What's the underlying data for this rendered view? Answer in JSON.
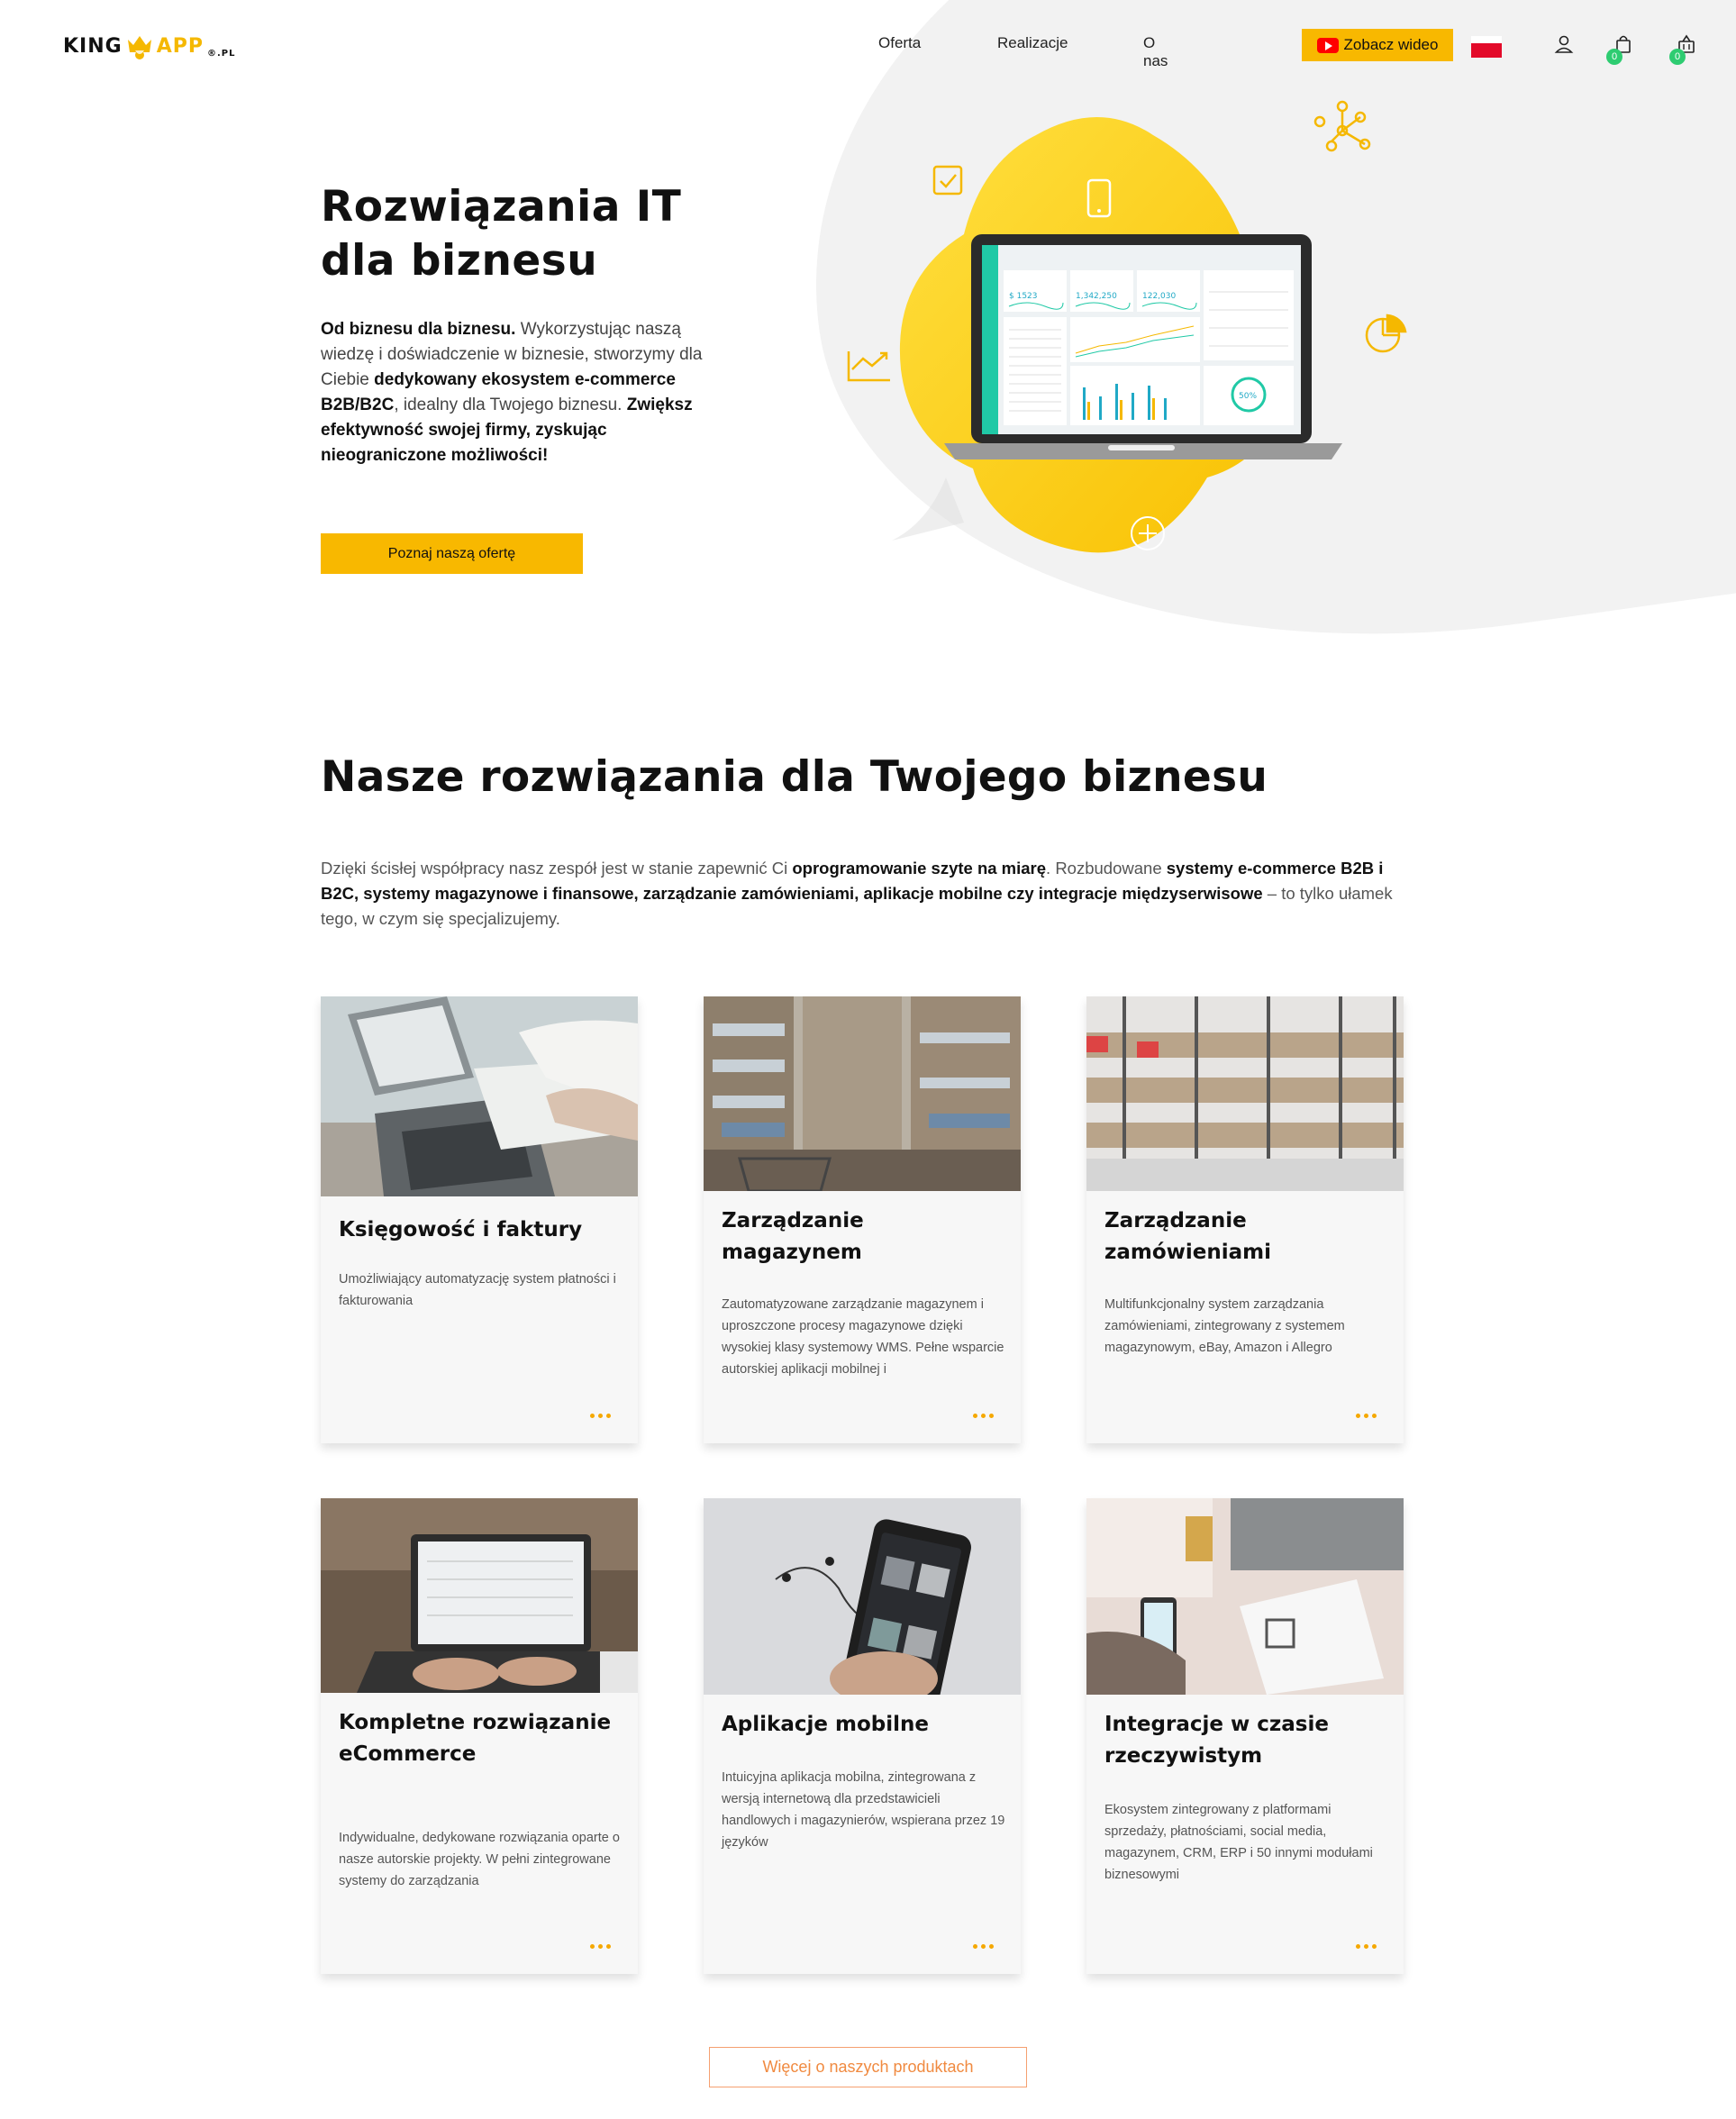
{
  "brand": {
    "left": "KING",
    "right": "APP",
    "suffix": "®.PL"
  },
  "nav": {
    "items": [
      "Oferta",
      "Realizacje",
      "O nas"
    ]
  },
  "header": {
    "video_label": "Zobacz wideo",
    "cart_count": "0",
    "basket_count": "0"
  },
  "hero": {
    "title": "Rozwiązania IT\ndla biznesu",
    "text_parts": {
      "p1": "Od biznesu dla biznesu.",
      "p2": " Wykorzystując naszą wiedzę i doświadczenie w biznesie, stworzymy dla Ciebie ",
      "p3": "dedykowany ekosystem e-commerce B2B/B2C",
      "p4": ", idealny dla Twojego biznesu. ",
      "p5": "Zwiększ efektywność swojej firmy, zyskując nieograniczone możliwości!"
    },
    "cta": "Poznaj naszą ofertę",
    "dashboard": {
      "v1": "$ 1523",
      "v2": "1,342,250",
      "v3": "122,030",
      "gauge": "50%"
    }
  },
  "section": {
    "title": "Nasze rozwiązania dla Twojego biznesu",
    "text_parts": {
      "p1": "Dzięki ścisłej współpracy nasz zespół jest w stanie zapewnić Ci ",
      "p2": "oprogramowanie szyte na miarę",
      "p3": ". Rozbudowane ",
      "p4": "systemy e-commerce B2B i B2C, systemy magazynowe i finansowe, zarządzanie zamówieniami, aplikacje mobilne czy integracje międzyserwisowe",
      "p5": " – to tylko ułamek tego, w czym się specjalizujemy."
    }
  },
  "cards": [
    {
      "title": "Księgowość i faktury",
      "text": "Umożliwiający automatyzację system płatności i fakturowania"
    },
    {
      "title": "Zarządzanie magazynem",
      "text": "Zautomatyzowane zarządzanie magazynem i uproszczone procesy magazynowe dzięki wysokiej klasy systemowy WMS. Pełne wsparcie autorskiej aplikacji mobilnej i"
    },
    {
      "title": "Zarządzanie zamówieniami",
      "text": "Multifunkcjonalny system zarządzania zamówieniami, zintegrowany z systemem magazynowym, eBay, Amazon i Allegro"
    },
    {
      "title": "Kompletne rozwiązanie eCommerce",
      "text": "Indywidualne, dedykowane rozwiązania oparte o nasze autorskie projekty. W pełni zintegrowane systemy do zarządzania"
    },
    {
      "title": "Aplikacje mobilne",
      "text": "Intuicyjna aplikacja mobilna, zintegrowana z wersją internetową dla przedstawicieli handlowych i magazynierów, wspierana przez 19 języków"
    },
    {
      "title": "Integracje w czasie rzeczywistym",
      "text": "Ekosystem zintegrowany z platformami sprzedaży, płatnościami, social media, magazynem, CRM, ERP i 50 innymi modułami biznesowymi"
    }
  ],
  "more_button": "Więcej o naszych produktach",
  "colors": {
    "accent": "#f8b800",
    "badge": "#2ecc71",
    "more_dots": "#f5a800"
  }
}
